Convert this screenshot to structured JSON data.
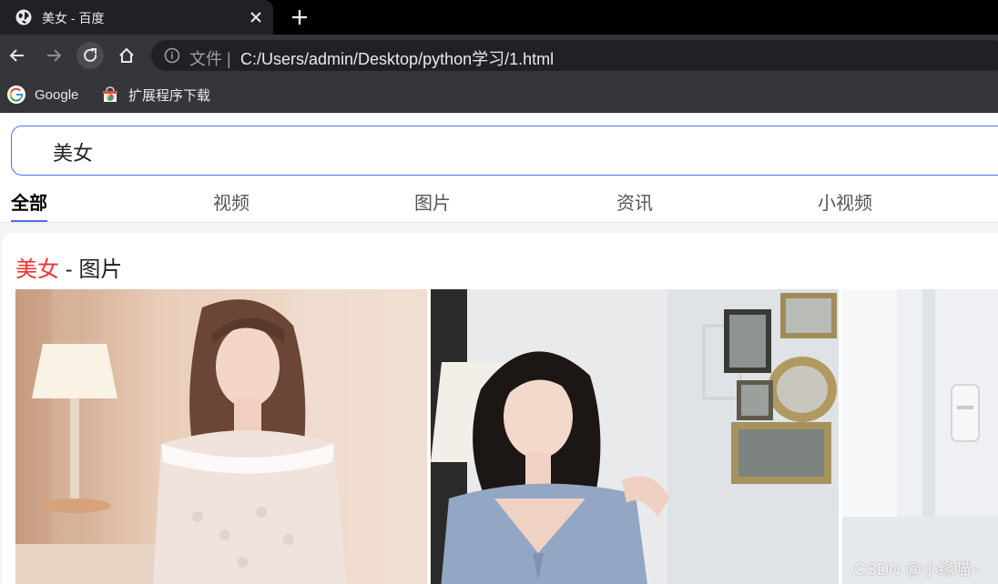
{
  "browser": {
    "tab": {
      "title": "美女 - 百度",
      "favicon": "globe-icon"
    },
    "new_tab_icon": "plus-icon",
    "address": {
      "scheme_label": "文件 |",
      "url": "C:/Users/admin/Desktop/python学习/1.html"
    },
    "bookmarks": [
      {
        "label": "Google",
        "icon": "google-icon"
      },
      {
        "label": "扩展程序下载",
        "icon": "extensions-store-icon"
      }
    ]
  },
  "search": {
    "query": "美女",
    "tabs": [
      "全部",
      "视频",
      "图片",
      "资讯",
      "小视频"
    ],
    "active_tab": "全部"
  },
  "result_card": {
    "title_highlight": "美女",
    "title_rest": " - 图片"
  },
  "watermark": "CSDN @小缘喵~",
  "colors": {
    "accent": "#4e6ef2",
    "highlight": "#f73131",
    "chrome_dark": "#35363a"
  }
}
